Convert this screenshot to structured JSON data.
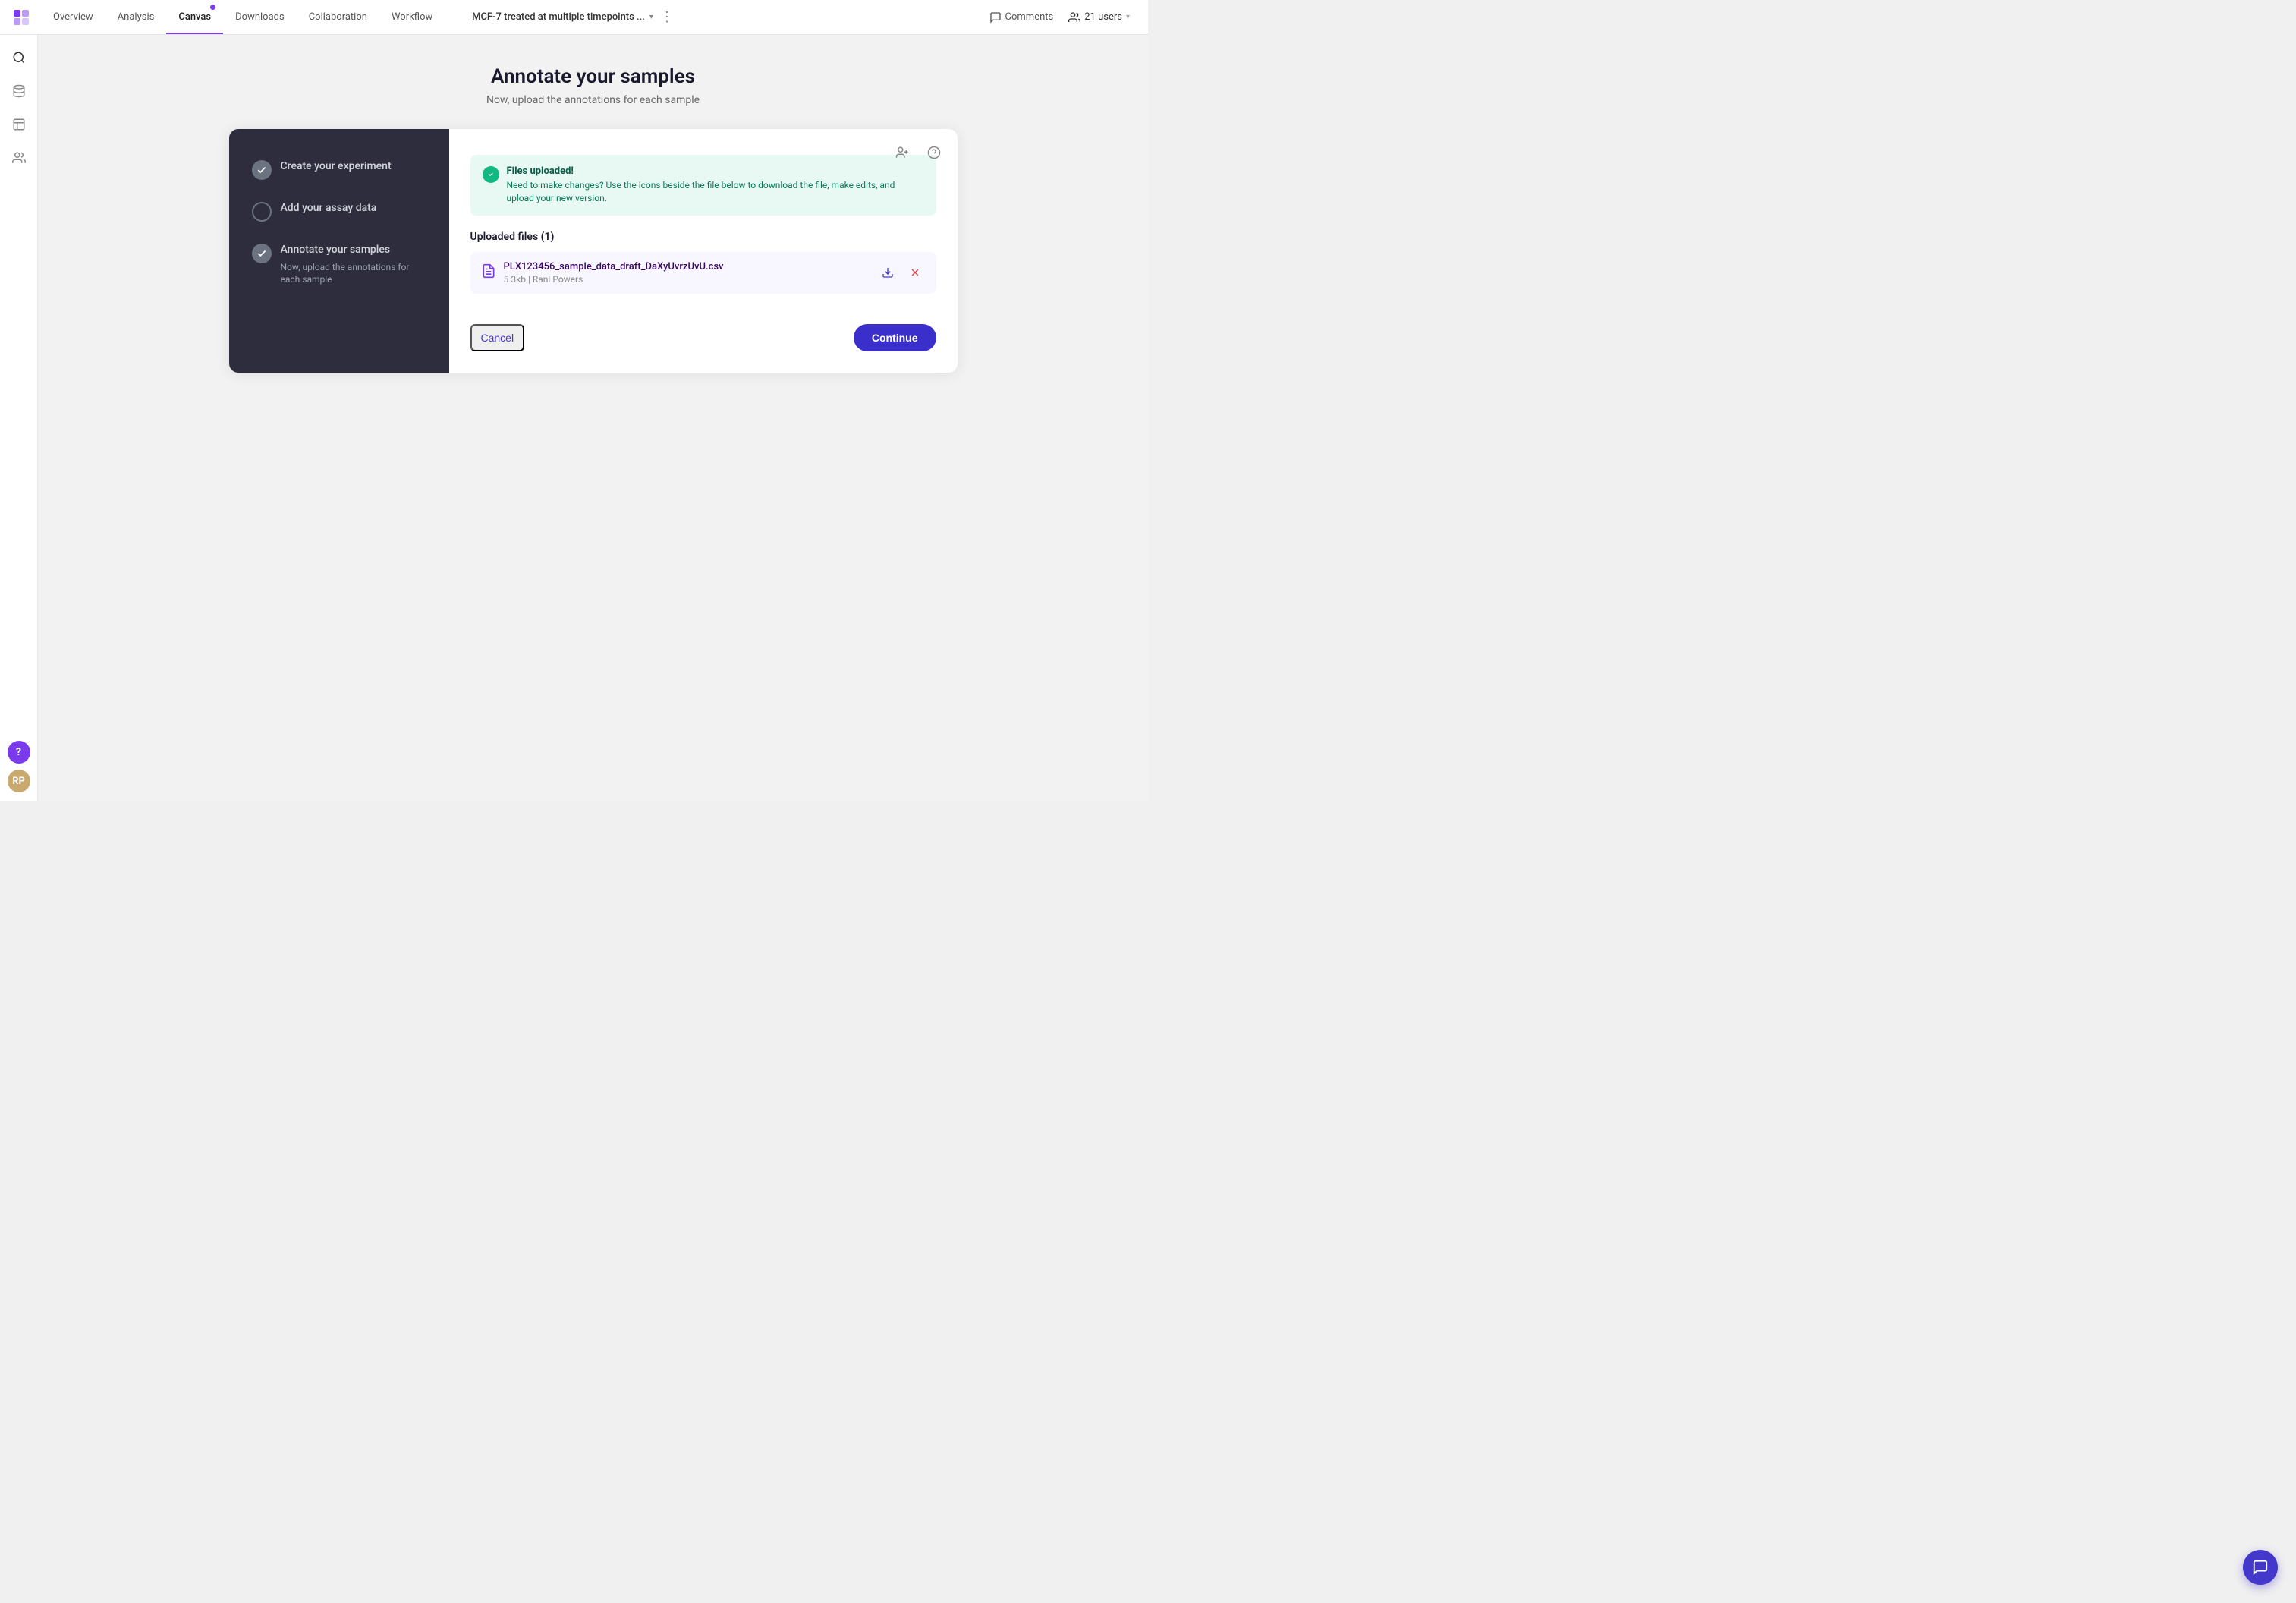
{
  "header": {
    "logo_label": "App Logo",
    "tabs": [
      {
        "id": "overview",
        "label": "Overview",
        "active": false
      },
      {
        "id": "analysis",
        "label": "Analysis",
        "active": false
      },
      {
        "id": "canvas",
        "label": "Canvas",
        "active": true,
        "has_dot": true
      },
      {
        "id": "downloads",
        "label": "Downloads",
        "active": false
      },
      {
        "id": "collaboration",
        "label": "Collaboration",
        "active": false
      },
      {
        "id": "workflow",
        "label": "Workflow",
        "active": false
      }
    ],
    "project_title": "MCF-7 treated at multiple timepoints ...",
    "more_label": "⋮",
    "comments_label": "Comments",
    "users_label": "21 users"
  },
  "sidebar": {
    "icons": [
      {
        "id": "search",
        "symbol": "🔍"
      },
      {
        "id": "data",
        "symbol": "🗄"
      },
      {
        "id": "chart",
        "symbol": "📊"
      },
      {
        "id": "people",
        "symbol": "👥"
      }
    ],
    "help_label": "?",
    "avatar_label": "RP"
  },
  "page": {
    "title": "Annotate your samples",
    "subtitle": "Now, upload the annotations for each sample"
  },
  "steps": [
    {
      "id": "create",
      "label": "Create your experiment",
      "status": "completed",
      "desc": ""
    },
    {
      "id": "assay",
      "label": "Add your assay data",
      "status": "circle",
      "desc": ""
    },
    {
      "id": "annotate",
      "label": "Annotate your samples",
      "status": "completed",
      "desc": "Now, upload the annotations for each sample"
    }
  ],
  "right_panel": {
    "add_user_icon": "person+",
    "help_icon": "?",
    "banner": {
      "title": "Files uploaded!",
      "message": "Need to make changes? Use the icons beside the file below to download the file, make edits, and upload your new version."
    },
    "uploaded_files_label": "Uploaded files (1)",
    "files": [
      {
        "name": "PLX123456_sample_data_draft_DaXyUvrzUvU.csv",
        "size": "5.3kb",
        "uploader": "Rani Powers"
      }
    ],
    "cancel_label": "Cancel",
    "continue_label": "Continue"
  }
}
